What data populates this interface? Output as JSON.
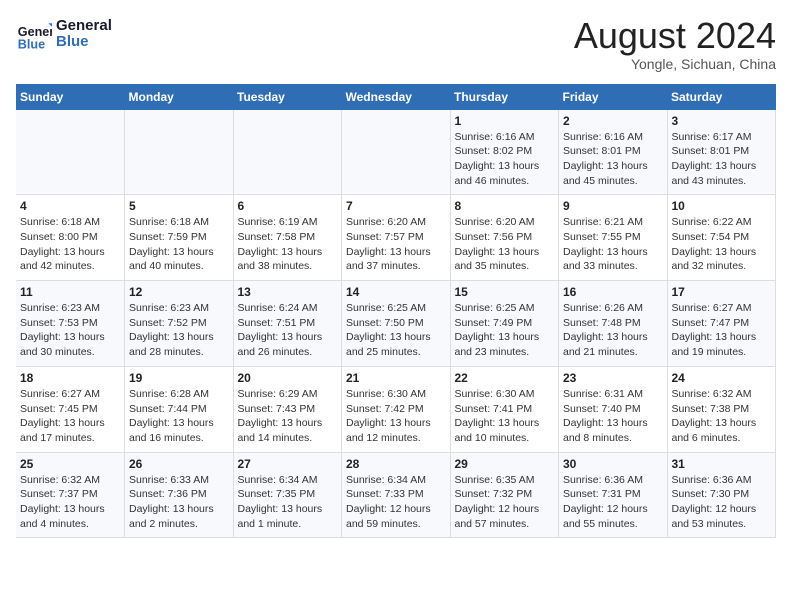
{
  "header": {
    "logo_line1": "General",
    "logo_line2": "Blue",
    "month_title": "August 2024",
    "location": "Yongle, Sichuan, China"
  },
  "days_of_week": [
    "Sunday",
    "Monday",
    "Tuesday",
    "Wednesday",
    "Thursday",
    "Friday",
    "Saturday"
  ],
  "weeks": [
    [
      {
        "day": "",
        "info": ""
      },
      {
        "day": "",
        "info": ""
      },
      {
        "day": "",
        "info": ""
      },
      {
        "day": "",
        "info": ""
      },
      {
        "day": "1",
        "info": "Sunrise: 6:16 AM\nSunset: 8:02 PM\nDaylight: 13 hours\nand 46 minutes."
      },
      {
        "day": "2",
        "info": "Sunrise: 6:16 AM\nSunset: 8:01 PM\nDaylight: 13 hours\nand 45 minutes."
      },
      {
        "day": "3",
        "info": "Sunrise: 6:17 AM\nSunset: 8:01 PM\nDaylight: 13 hours\nand 43 minutes."
      }
    ],
    [
      {
        "day": "4",
        "info": "Sunrise: 6:18 AM\nSunset: 8:00 PM\nDaylight: 13 hours\nand 42 minutes."
      },
      {
        "day": "5",
        "info": "Sunrise: 6:18 AM\nSunset: 7:59 PM\nDaylight: 13 hours\nand 40 minutes."
      },
      {
        "day": "6",
        "info": "Sunrise: 6:19 AM\nSunset: 7:58 PM\nDaylight: 13 hours\nand 38 minutes."
      },
      {
        "day": "7",
        "info": "Sunrise: 6:20 AM\nSunset: 7:57 PM\nDaylight: 13 hours\nand 37 minutes."
      },
      {
        "day": "8",
        "info": "Sunrise: 6:20 AM\nSunset: 7:56 PM\nDaylight: 13 hours\nand 35 minutes."
      },
      {
        "day": "9",
        "info": "Sunrise: 6:21 AM\nSunset: 7:55 PM\nDaylight: 13 hours\nand 33 minutes."
      },
      {
        "day": "10",
        "info": "Sunrise: 6:22 AM\nSunset: 7:54 PM\nDaylight: 13 hours\nand 32 minutes."
      }
    ],
    [
      {
        "day": "11",
        "info": "Sunrise: 6:23 AM\nSunset: 7:53 PM\nDaylight: 13 hours\nand 30 minutes."
      },
      {
        "day": "12",
        "info": "Sunrise: 6:23 AM\nSunset: 7:52 PM\nDaylight: 13 hours\nand 28 minutes."
      },
      {
        "day": "13",
        "info": "Sunrise: 6:24 AM\nSunset: 7:51 PM\nDaylight: 13 hours\nand 26 minutes."
      },
      {
        "day": "14",
        "info": "Sunrise: 6:25 AM\nSunset: 7:50 PM\nDaylight: 13 hours\nand 25 minutes."
      },
      {
        "day": "15",
        "info": "Sunrise: 6:25 AM\nSunset: 7:49 PM\nDaylight: 13 hours\nand 23 minutes."
      },
      {
        "day": "16",
        "info": "Sunrise: 6:26 AM\nSunset: 7:48 PM\nDaylight: 13 hours\nand 21 minutes."
      },
      {
        "day": "17",
        "info": "Sunrise: 6:27 AM\nSunset: 7:47 PM\nDaylight: 13 hours\nand 19 minutes."
      }
    ],
    [
      {
        "day": "18",
        "info": "Sunrise: 6:27 AM\nSunset: 7:45 PM\nDaylight: 13 hours\nand 17 minutes."
      },
      {
        "day": "19",
        "info": "Sunrise: 6:28 AM\nSunset: 7:44 PM\nDaylight: 13 hours\nand 16 minutes."
      },
      {
        "day": "20",
        "info": "Sunrise: 6:29 AM\nSunset: 7:43 PM\nDaylight: 13 hours\nand 14 minutes."
      },
      {
        "day": "21",
        "info": "Sunrise: 6:30 AM\nSunset: 7:42 PM\nDaylight: 13 hours\nand 12 minutes."
      },
      {
        "day": "22",
        "info": "Sunrise: 6:30 AM\nSunset: 7:41 PM\nDaylight: 13 hours\nand 10 minutes."
      },
      {
        "day": "23",
        "info": "Sunrise: 6:31 AM\nSunset: 7:40 PM\nDaylight: 13 hours\nand 8 minutes."
      },
      {
        "day": "24",
        "info": "Sunrise: 6:32 AM\nSunset: 7:38 PM\nDaylight: 13 hours\nand 6 minutes."
      }
    ],
    [
      {
        "day": "25",
        "info": "Sunrise: 6:32 AM\nSunset: 7:37 PM\nDaylight: 13 hours\nand 4 minutes."
      },
      {
        "day": "26",
        "info": "Sunrise: 6:33 AM\nSunset: 7:36 PM\nDaylight: 13 hours\nand 2 minutes."
      },
      {
        "day": "27",
        "info": "Sunrise: 6:34 AM\nSunset: 7:35 PM\nDaylight: 13 hours\nand 1 minute."
      },
      {
        "day": "28",
        "info": "Sunrise: 6:34 AM\nSunset: 7:33 PM\nDaylight: 12 hours\nand 59 minutes."
      },
      {
        "day": "29",
        "info": "Sunrise: 6:35 AM\nSunset: 7:32 PM\nDaylight: 12 hours\nand 57 minutes."
      },
      {
        "day": "30",
        "info": "Sunrise: 6:36 AM\nSunset: 7:31 PM\nDaylight: 12 hours\nand 55 minutes."
      },
      {
        "day": "31",
        "info": "Sunrise: 6:36 AM\nSunset: 7:30 PM\nDaylight: 12 hours\nand 53 minutes."
      }
    ]
  ]
}
